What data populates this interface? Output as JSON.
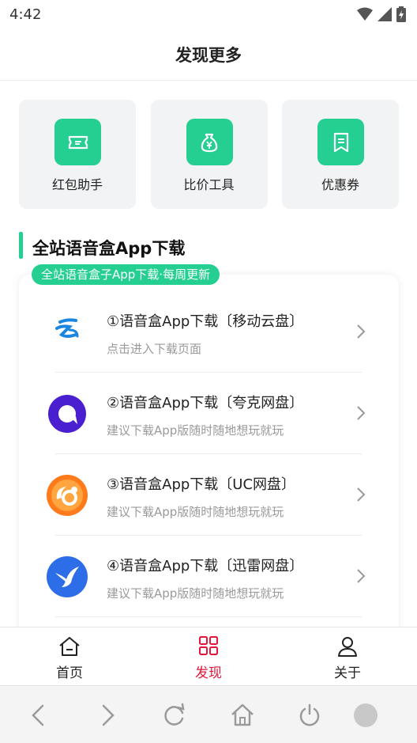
{
  "status": {
    "time": "4:42"
  },
  "header": {
    "title": "发现更多"
  },
  "tools": [
    {
      "label": "红包助手",
      "icon": "ticket-icon"
    },
    {
      "label": "比价工具",
      "icon": "money-bag-icon"
    },
    {
      "label": "优惠券",
      "icon": "coupon-icon"
    }
  ],
  "section": {
    "title": "全站语音盒App下载",
    "tag": "全站语音盒子App下载·每周更新"
  },
  "downloads": [
    {
      "title": "①语音盒App下载〔移动云盘〕",
      "subtitle": "点击进入下载页面",
      "icon": "mobile-cloud-icon"
    },
    {
      "title": "②语音盒App下载〔夸克网盘〕",
      "subtitle": "建议下载App版随时随地想玩就玩",
      "icon": "quark-icon"
    },
    {
      "title": "③语音盒App下载〔UC网盘〕",
      "subtitle": "建议下载App版随时随地想玩就玩",
      "icon": "uc-icon"
    },
    {
      "title": "④语音盒App下载〔迅雷网盘〕",
      "subtitle": "建议下载App版随时随地想玩就玩",
      "icon": "xunlei-icon"
    }
  ],
  "tabbar": [
    {
      "label": "首页",
      "icon": "home-icon",
      "active": false
    },
    {
      "label": "发现",
      "icon": "grid-icon",
      "active": true
    },
    {
      "label": "关于",
      "icon": "user-icon",
      "active": false
    }
  ],
  "colors": {
    "accent": "#25cf92",
    "active_tab": "#e0173a",
    "text": "#222222",
    "muted": "#9a9a9a"
  },
  "browser_nav": [
    "back-icon",
    "forward-icon",
    "refresh-icon",
    "home-icon",
    "power-icon",
    "circle-icon"
  ]
}
